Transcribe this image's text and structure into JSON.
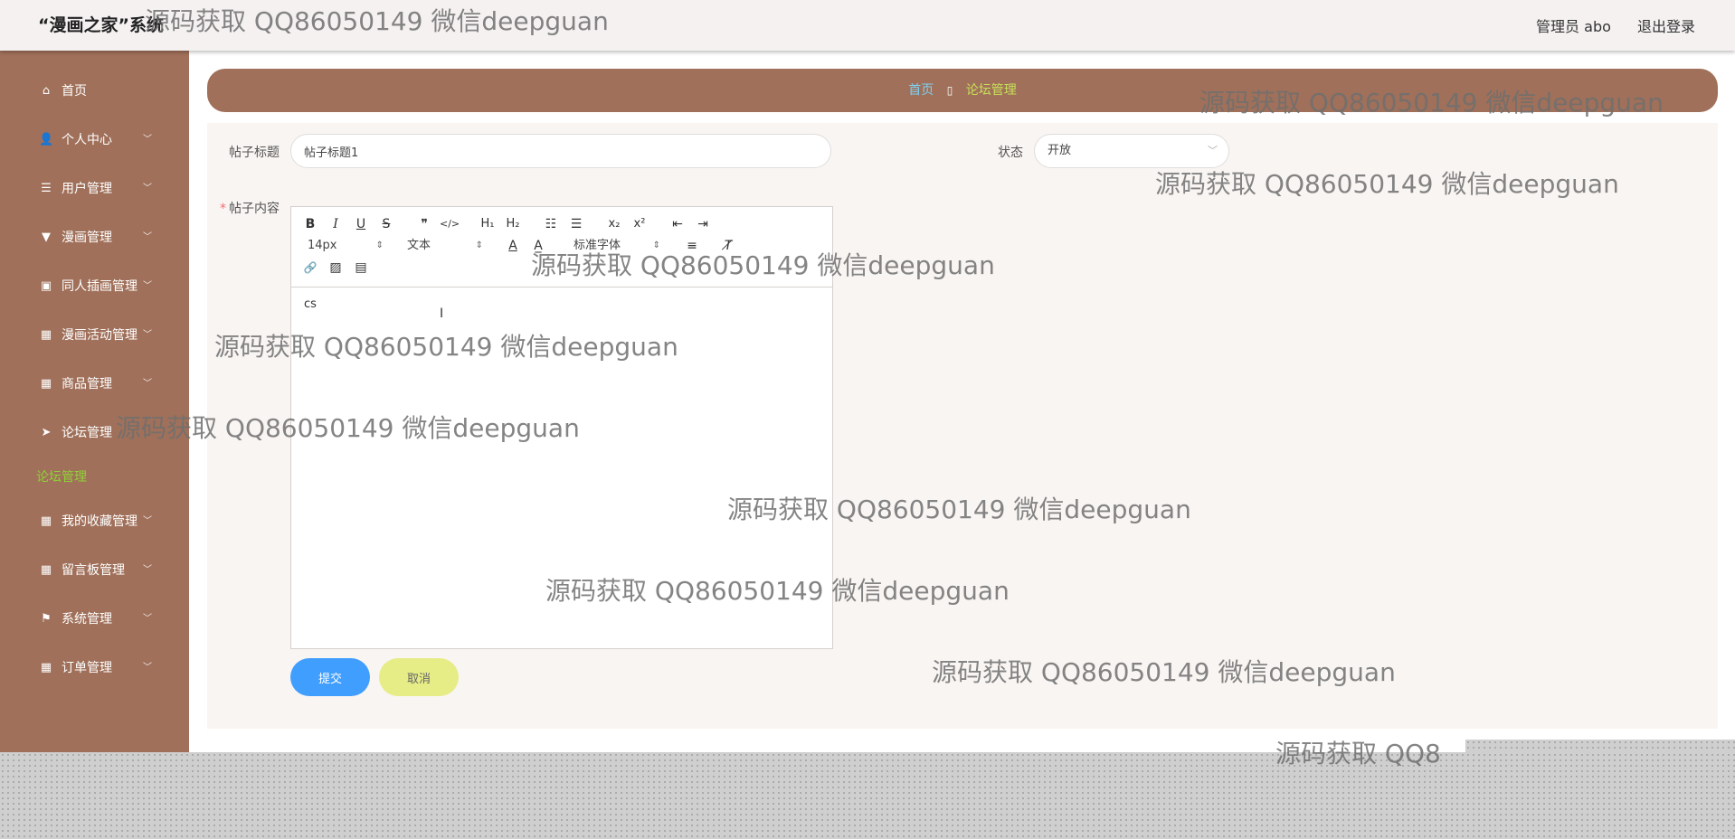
{
  "header": {
    "title": "“漫画之家”系统",
    "user": "管理员 abo",
    "logout": "退出登录"
  },
  "sidebar": {
    "items": [
      {
        "label": "首页",
        "icon": "home-icon",
        "glyph": "⌂",
        "chevron": false
      },
      {
        "label": "个人中心",
        "icon": "user-icon",
        "glyph": "👤",
        "chevron": true
      },
      {
        "label": "用户管理",
        "icon": "sliders-icon",
        "glyph": "☰",
        "chevron": true
      },
      {
        "label": "漫画管理",
        "icon": "brush-icon",
        "glyph": "▼",
        "chevron": true
      },
      {
        "label": "同人插画管理",
        "icon": "briefcase-icon",
        "glyph": "▣",
        "chevron": true
      },
      {
        "label": "漫画活动管理",
        "icon": "grid-icon",
        "glyph": "▦",
        "chevron": true
      },
      {
        "label": "商品管理",
        "icon": "apps-icon",
        "glyph": "▦",
        "chevron": true
      },
      {
        "label": "论坛管理",
        "icon": "send-icon",
        "glyph": "➤",
        "chevron": false
      }
    ],
    "active_sub": "论坛管理",
    "items_after": [
      {
        "label": "我的收藏管理",
        "icon": "grid-icon",
        "glyph": "▦",
        "chevron": true
      },
      {
        "label": "留言板管理",
        "icon": "grid-icon",
        "glyph": "▦",
        "chevron": true
      },
      {
        "label": "系统管理",
        "icon": "flag-icon",
        "glyph": "⚑",
        "chevron": true
      },
      {
        "label": "订单管理",
        "icon": "grid-icon",
        "glyph": "▦",
        "chevron": true
      }
    ]
  },
  "breadcrumb": {
    "home": "首页",
    "separator": "▯",
    "current": "论坛管理"
  },
  "form": {
    "title_label": "帖子标题",
    "title_value": "帖子标题1",
    "status_label": "状态",
    "status_value": "开放",
    "content_label": "帖子内容",
    "content_required": "*",
    "content_value": "cs",
    "submit": "提交",
    "cancel": "取消"
  },
  "editor_toolbar": {
    "bold": "B",
    "italic": "I",
    "underline": "U",
    "strike": "S",
    "quote": "❞",
    "code": "</>",
    "h1": "H₁",
    "h2": "H₂",
    "ordered": "☷",
    "bullet": "☰",
    "sub": "x₂",
    "sup": "x²",
    "outdent": "⇤",
    "indent": "⇥",
    "size": "14px",
    "header": "文本",
    "color": "A",
    "background": "A̲",
    "font": "标准字体",
    "align": "≡",
    "clean": "T̸",
    "link": "🔗",
    "image": "▨",
    "video": "▤"
  },
  "watermark": "源码获取 QQ86050149 微信deepguan",
  "watermark_partial": "源码获取 QQ8",
  "cursor_glyph": "I"
}
